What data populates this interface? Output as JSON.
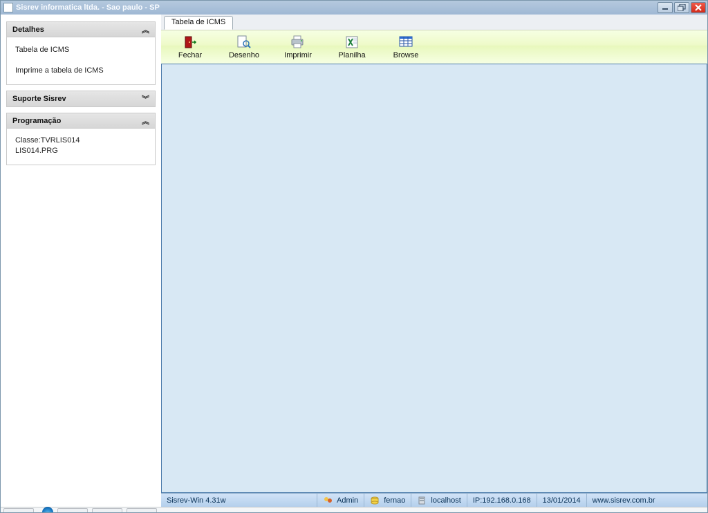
{
  "window": {
    "title": "Sisrev informatica ltda. - Sao paulo - SP"
  },
  "sidebar": {
    "detalhes": {
      "title": "Detalhes",
      "item1": "Tabela de ICMS",
      "item2": "Imprime a tabela de ICMS"
    },
    "suporte": {
      "title": "Suporte Sisrev"
    },
    "programacao": {
      "title": "Programação",
      "line1": "Classe:TVRLIS014",
      "line2": "LIS014.PRG"
    }
  },
  "tabs": {
    "tab1": "Tabela de ICMS"
  },
  "toolbar": {
    "fechar": "Fechar",
    "desenho": "Desenho",
    "imprimir": "Imprimir",
    "planilha": "Planilha",
    "browse": "Browse"
  },
  "status": {
    "app": "Sisrev-Win 4.31w",
    "user": "Admin",
    "db": "fernao",
    "host": "localhost",
    "ip": "IP:192.168.0.168",
    "date": "13/01/2014",
    "site": "www.sisrev.com.br"
  }
}
